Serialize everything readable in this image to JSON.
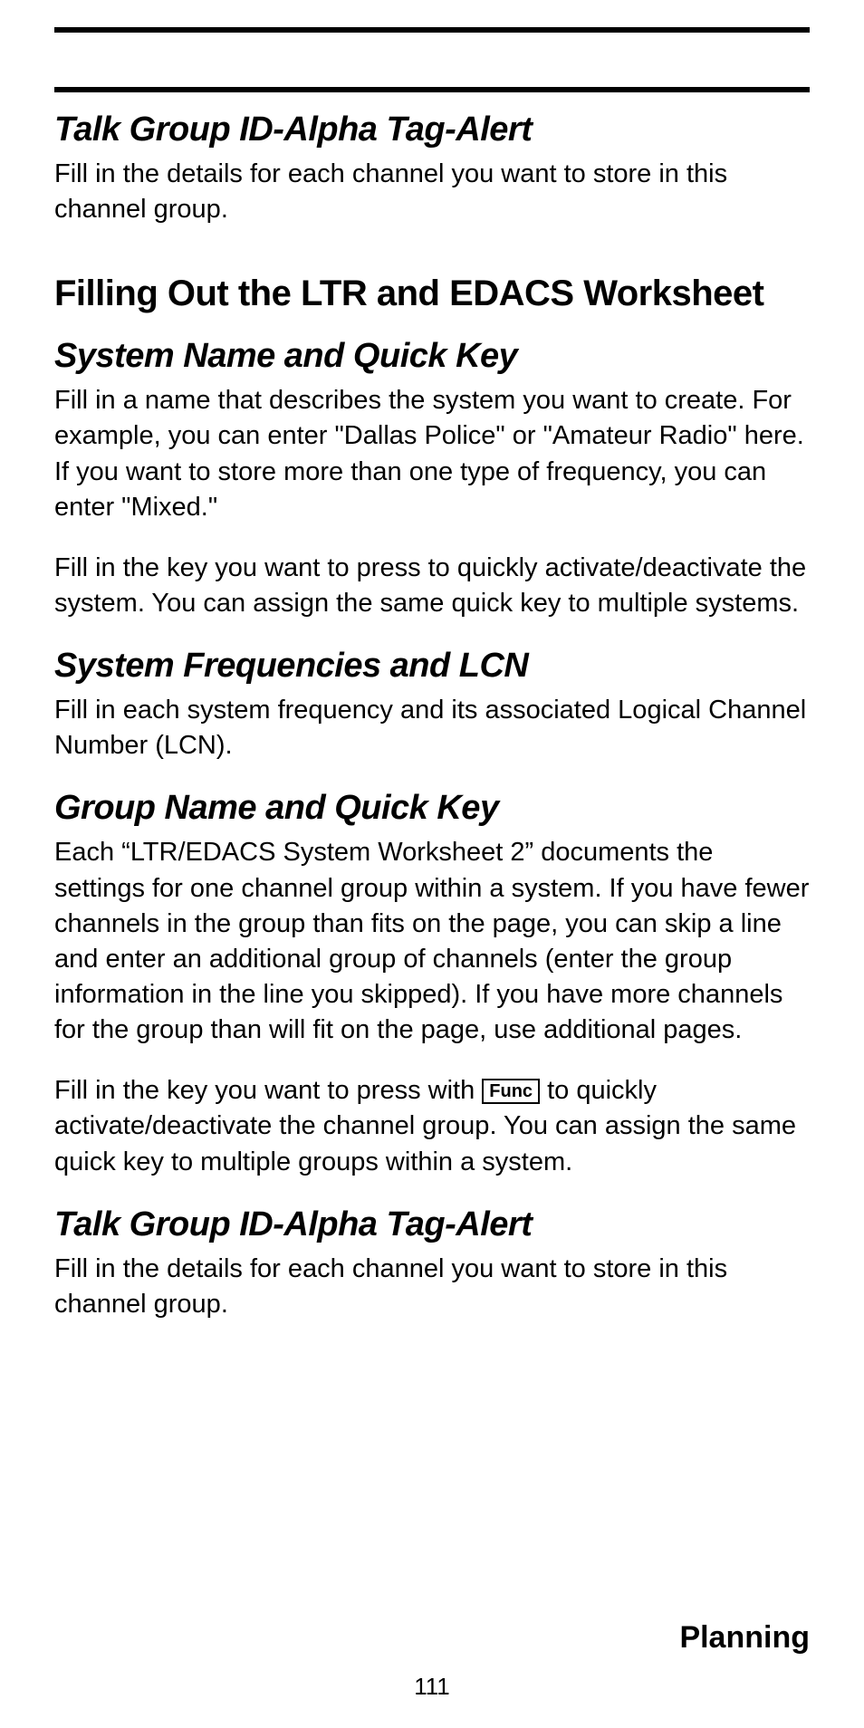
{
  "sec1": {
    "heading": "Talk Group ID-Alpha Tag-Alert",
    "p1": "Fill in the details for each channel you want to store in this channel group."
  },
  "main_heading": "Filling Out the LTR and EDACS Worksheet",
  "sec2": {
    "heading": "System Name and Quick Key",
    "p1": "Fill in a name that describes the system you want to create. For example, you can enter \"Dallas Police\" or \"Amateur Radio\" here. If you want to store more than one type of frequency, you can enter \"Mixed.\"",
    "p2": "Fill in the key you want to press to quickly activate/deactivate the system. You can assign the same quick key to multiple systems."
  },
  "sec3": {
    "heading": "System Frequencies and LCN",
    "p1": "Fill in each system frequency and its associated Logical Channel Number (LCN)."
  },
  "sec4": {
    "heading": "Group Name and Quick Key",
    "p1": "Each “LTR/EDACS System Worksheet 2” documents the settings for one channel group within a system. If you have fewer channels in the group than fits on the page, you can skip a line and enter an additional group of channels (enter the group information in the line you skipped). If you have more channels for the group than will fit on the page, use additional pages.",
    "p2a": "Fill in the key you want to press with ",
    "funckey": "Func",
    "p2b": " to quickly activate/deactivate the channel group. You can assign the same quick key to multiple groups within a system."
  },
  "sec5": {
    "heading": "Talk Group ID-Alpha Tag-Alert",
    "p1": "Fill in the details for each channel you want to store in this channel group."
  },
  "footer": {
    "section": "Planning",
    "page": "111"
  }
}
